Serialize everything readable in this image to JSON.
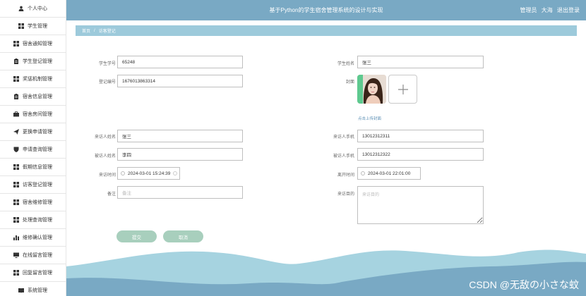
{
  "app_title": "基于Python的学生宿舍管理系统的设计与实现",
  "user": {
    "role": "管理员",
    "name": "大海",
    "logout": "退出登录"
  },
  "sidebar": {
    "items": [
      {
        "label": "个人中心",
        "icon": "user-icon"
      },
      {
        "label": "学生管理",
        "icon": "grid-icon"
      },
      {
        "label": "宿舍通知管理",
        "icon": "grid-icon"
      },
      {
        "label": "学生登记管理",
        "icon": "clipboard-icon"
      },
      {
        "label": "奖惩机制管理",
        "icon": "grid-icon"
      },
      {
        "label": "宿舍信息管理",
        "icon": "clipboard-icon"
      },
      {
        "label": "宿舍房间管理",
        "icon": "briefcase-icon"
      },
      {
        "label": "更换申请管理",
        "icon": "send-icon"
      },
      {
        "label": "申请查询管理",
        "icon": "shield-icon"
      },
      {
        "label": "假期信息管理",
        "icon": "grid-icon"
      },
      {
        "label": "访客登记管理",
        "icon": "grid-icon"
      },
      {
        "label": "宿舍维修管理",
        "icon": "grid-icon"
      },
      {
        "label": "处理查询管理",
        "icon": "grid-icon"
      },
      {
        "label": "维修确认管理",
        "icon": "bar-chart-icon"
      },
      {
        "label": "在线留言管理",
        "icon": "monitor-icon"
      },
      {
        "label": "回复留言管理",
        "icon": "grid-icon"
      },
      {
        "label": "系统管理",
        "icon": "book-icon"
      }
    ]
  },
  "breadcrumb": {
    "home": "首页",
    "separator": "/",
    "current": "访客登记"
  },
  "form": {
    "student_no": {
      "label": "学生学号",
      "value": "65248"
    },
    "student_name": {
      "label": "学生姓名",
      "value": "张三"
    },
    "reg_no": {
      "label": "登记编号",
      "value": "1676013863314"
    },
    "cover": {
      "label": "封面",
      "upload_hint": "点击上传封面",
      "icon": "plus-icon"
    },
    "visitor_name": {
      "label": "来访人姓名",
      "value": "张三"
    },
    "visitor_phone": {
      "label": "来访人手机",
      "value": "13012312311"
    },
    "visitee_name": {
      "label": "被访人姓名",
      "value": "李四"
    },
    "visitee_phone": {
      "label": "被访人手机",
      "value": "13012312322"
    },
    "visit_time": {
      "label": "来访时间",
      "value": "2024-03-01 15:24:39"
    },
    "leave_time": {
      "label": "离开时间",
      "value": "2024-03-01 22:01:00"
    },
    "remark": {
      "label": "备注",
      "placeholder": "备注"
    },
    "purpose": {
      "label": "来访目的",
      "placeholder": "来访目的"
    },
    "submit": "提交",
    "cancel": "取消"
  },
  "colors": {
    "header": "#79a9c4",
    "breadcrumb": "#9dcadb",
    "button": "#a8cfbd",
    "wave_light": "#a6d3e0",
    "wave_dark": "#79a9c4"
  },
  "watermark": "CSDN @无敌の小さな蚊"
}
